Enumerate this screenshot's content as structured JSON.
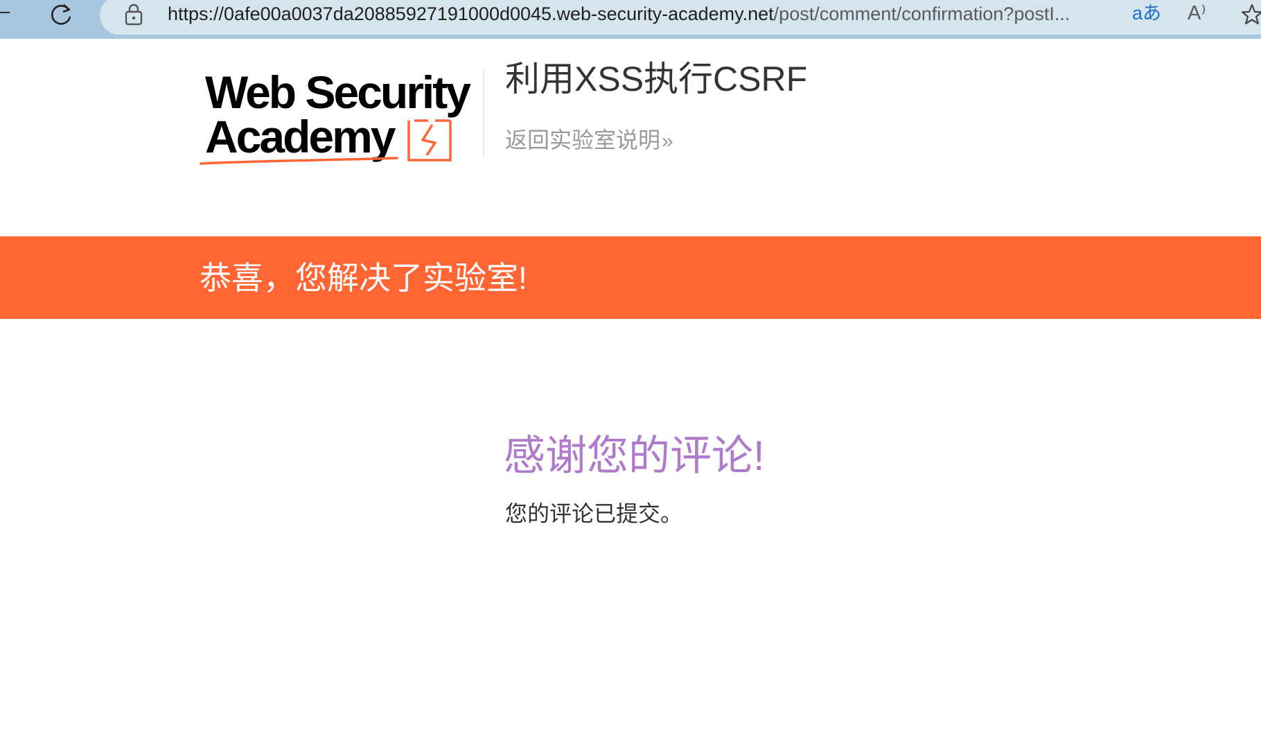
{
  "browser": {
    "url_host": "https://0afe00a0037da20885927191000d0045.web-security-academy.net",
    "url_path": "/post/comment/confirmation?postI...",
    "translate_label": "aあ",
    "read_aloud_label": "A⁾"
  },
  "header": {
    "logo_line1": "Web Security",
    "logo_line2": "Academy",
    "lab_title": "利用XSS执行CSRF",
    "back_link": "返回实验室说明",
    "back_link_chevron": "»"
  },
  "banner": {
    "message": "恭喜，您解决了实验室!"
  },
  "main": {
    "title": "感谢您的评论!",
    "message": "您的评论已提交。"
  },
  "colors": {
    "banner": "#ff6633",
    "title": "#b07acb",
    "browser_bar": "#a8c6dd",
    "address_bar": "#d6e4ee"
  }
}
